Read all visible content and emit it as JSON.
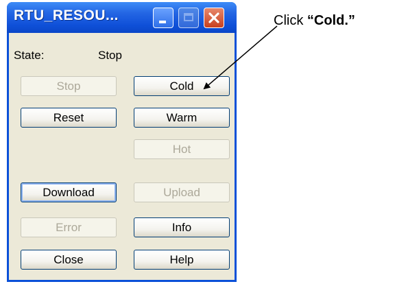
{
  "window": {
    "title": "RTU_RESOU..."
  },
  "state": {
    "label": "State:",
    "value": "Stop"
  },
  "buttons": {
    "stop": "Stop",
    "cold": "Cold",
    "reset": "Reset",
    "warm": "Warm",
    "hot": "Hot",
    "download": "Download",
    "upload": "Upload",
    "error": "Error",
    "info": "Info",
    "close": "Close",
    "help": "Help"
  },
  "annotation": {
    "prefix": "Click ",
    "emphasis": "“Cold.”"
  },
  "colors": {
    "titlebar": "#0a50d8",
    "client": "#ece9d8",
    "close_button": "#c8401f"
  }
}
